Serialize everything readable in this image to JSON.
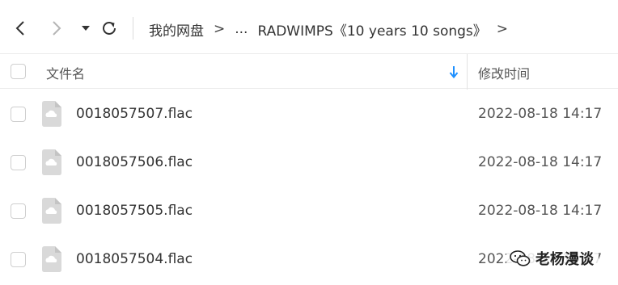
{
  "toolbar": {
    "back_icon": "chevron-left",
    "forward_icon": "chevron-right",
    "menu_icon": "caret-down",
    "refresh_icon": "refresh"
  },
  "breadcrumb": {
    "root": "我的网盘",
    "sep1": ">",
    "ellipsis": "...",
    "current": "RADWIMPS《10 years 10 songs》",
    "sep2": ">",
    "sep3": ">"
  },
  "header": {
    "name_label": "文件名",
    "time_label": "修改时间",
    "sort_icon": "arrow-down",
    "accent_color": "#1e90ff"
  },
  "files": [
    {
      "name": "0018057507.flac",
      "modified": "2022-08-18 14:17"
    },
    {
      "name": "0018057506.flac",
      "modified": "2022-08-18 14:17"
    },
    {
      "name": "0018057505.flac",
      "modified": "2022-08-18 14:17"
    },
    {
      "name": "0018057504.flac",
      "modified": "2022-08-18 14:17"
    }
  ],
  "watermark": {
    "text": "老杨漫谈",
    "icon": "wechat-logo"
  }
}
